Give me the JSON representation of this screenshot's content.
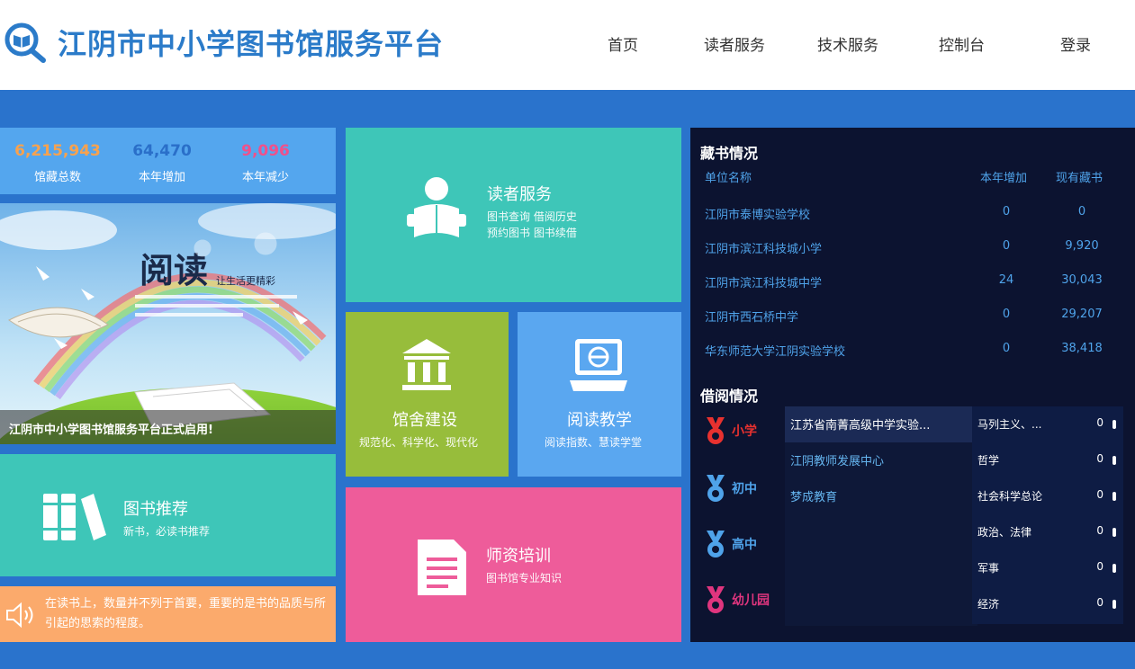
{
  "header": {
    "title": "江阴市中小学图书馆服务平台",
    "nav": [
      "首页",
      "读者服务",
      "技术服务",
      "控制台",
      "登录"
    ]
  },
  "stats": [
    {
      "value": "6,215,943",
      "label": "馆藏总数",
      "color": "#f8a24e"
    },
    {
      "value": "64,470",
      "label": "本年增加",
      "color": "#2a6fc9"
    },
    {
      "value": "9,096",
      "label": "本年减少",
      "color": "#f0508a"
    }
  ],
  "banner": {
    "caption": "江阴市中小学图书馆服务平台正式启用!",
    "art_title": "阅读",
    "art_subtitle": "让生活更精彩"
  },
  "tiles": {
    "reader_service": {
      "title": "读者服务",
      "sub1": "图书查询 借阅历史",
      "sub2": "预约图书 图书续借",
      "color": "#3ec6b8"
    },
    "library_building": {
      "title": "馆舍建设",
      "sub": "规范化、科学化、现代化",
      "color": "#97bd3b"
    },
    "reading_teaching": {
      "title": "阅读教学",
      "sub": "阅读指数、慧读学堂",
      "color": "#5aa7f0"
    },
    "book_recommend": {
      "title": "图书推荐",
      "sub": "新书，必读书推荐",
      "color": "#3ec6b8"
    },
    "teacher_training": {
      "title": "师资培训",
      "sub": "图书馆专业知识",
      "color": "#ee5c9a"
    }
  },
  "quote": {
    "text": "在读书上，数量并不列于首要，重要的是书的品质与所引起的思索的程度。",
    "icon": "speaker-icon"
  },
  "collection": {
    "title": "藏书情况",
    "headers": [
      "单位名称",
      "本年增加",
      "现有藏书"
    ],
    "rows": [
      {
        "name": "江阴市泰博实验学校",
        "added": "0",
        "total": "0"
      },
      {
        "name": "江阴市滨江科技城小学",
        "added": "0",
        "total": "9,920"
      },
      {
        "name": "江阴市滨江科技城中学",
        "added": "24",
        "total": "30,043"
      },
      {
        "name": "江阴市西石桥中学",
        "added": "0",
        "total": "29,207"
      },
      {
        "name": "华东师范大学江阴实验学校",
        "added": "0",
        "total": "38,418"
      }
    ]
  },
  "borrow": {
    "title": "借阅情况",
    "levels": [
      {
        "label": "小学",
        "color": "#e8312f"
      },
      {
        "label": "初中",
        "color": "#4fa3ea"
      },
      {
        "label": "高中",
        "color": "#4fa3ea"
      },
      {
        "label": "幼儿园",
        "color": "#e0357e"
      }
    ],
    "schools": [
      "江苏省南菁高级中学实验...",
      "江阴教师发展中心",
      "梦成教育"
    ],
    "categories": [
      {
        "name": "马列主义、...",
        "value": "0"
      },
      {
        "name": "哲学",
        "value": "0"
      },
      {
        "name": "社会科学总论",
        "value": "0"
      },
      {
        "name": "政治、法律",
        "value": "0"
      },
      {
        "name": "军事",
        "value": "0"
      },
      {
        "name": "经济",
        "value": "0"
      }
    ]
  }
}
